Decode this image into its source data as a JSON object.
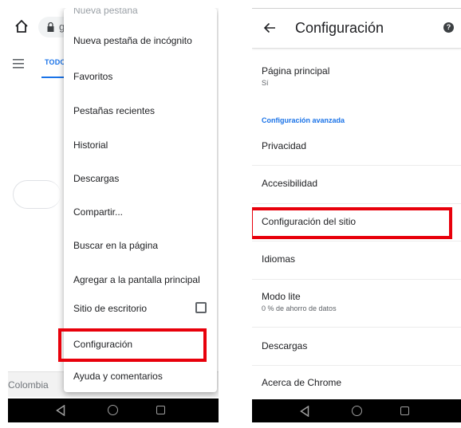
{
  "left_screen": {
    "url_fragment": "g",
    "google_tab": "TODO",
    "country": "Colombia",
    "menu": {
      "cut_item": "Nueva pestaña",
      "items": [
        "Nueva pestaña de incógnito",
        "Favoritos",
        "Pestañas recientes",
        "Historial",
        "Descargas",
        "Compartir...",
        "Buscar en la página",
        "Agregar a la pantalla principal",
        "Sitio de escritorio",
        "Configuración",
        "Ayuda y comentarios"
      ],
      "desktop_site_checked": false,
      "highlighted_item": "Configuración"
    }
  },
  "right_screen": {
    "title": "Configuración",
    "help_glyph": "?",
    "home_page": {
      "label": "Página principal",
      "value": "Sí"
    },
    "section_advanced": "Configuración avanzada",
    "items": {
      "privacy": "Privacidad",
      "accessibility": "Accesibilidad",
      "site_settings": "Configuración del sitio",
      "languages": "Idiomas",
      "lite_mode": "Modo lite",
      "lite_mode_sub": "0 % de ahorro de datos",
      "downloads": "Descargas",
      "about": "Acerca de Chrome"
    },
    "highlighted_item": "Configuración del sitio"
  },
  "colors": {
    "highlight": "#e8000b",
    "accent": "#1a73e8",
    "nav_bar": "#000000"
  },
  "icons": [
    "home-icon",
    "lock-icon",
    "hamburger-icon",
    "checkbox-icon",
    "back-arrow-icon",
    "help-icon",
    "nav-back-icon",
    "nav-home-icon",
    "nav-recent-icon"
  ]
}
